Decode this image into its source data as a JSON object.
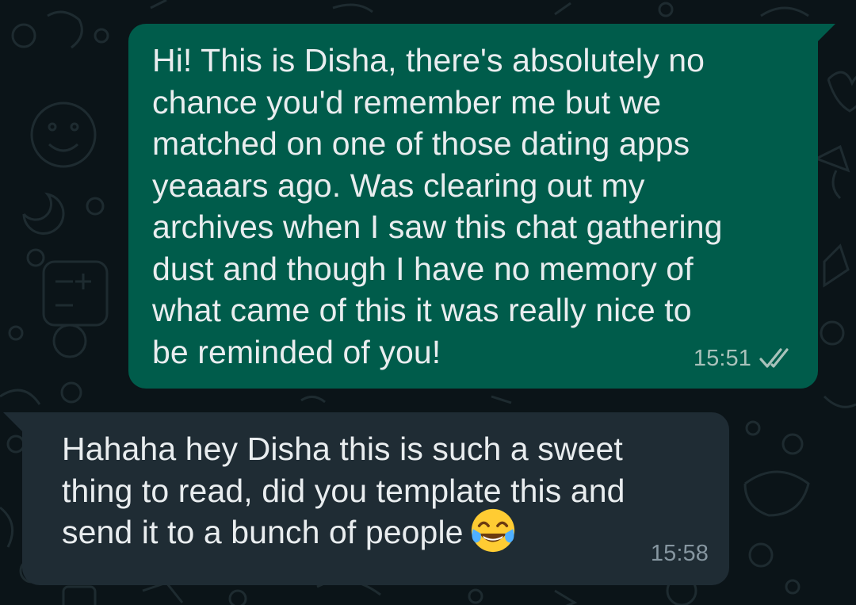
{
  "wallpaper_icon": "doodle-pattern",
  "colors": {
    "background": "#0b1418",
    "outgoing_bubble": "#005c4b",
    "incoming_bubble": "#1f2c34",
    "text": "#e9edef",
    "timestamp": "#a9c2bb"
  },
  "messages": [
    {
      "direction": "outgoing",
      "text": "Hi! This is Disha, there's absolutely no\nchance you'd remember me but we\nmatched on one of those dating apps\nyeaaars ago. Was clearing out my\narchives when I saw this chat gathering\ndust and though I have no memory of\nwhat came of this it was really nice to\nbe reminded of you!",
      "time": "15:51",
      "status_icon": "double-check-icon"
    },
    {
      "direction": "incoming",
      "text": "Hahaha hey Disha this is such a sweet\nthing to read, did you template this and\nsend it to a bunch of people",
      "emoji": "😂",
      "emoji_icon": "tears-of-joy-emoji",
      "time": "15:58"
    }
  ]
}
